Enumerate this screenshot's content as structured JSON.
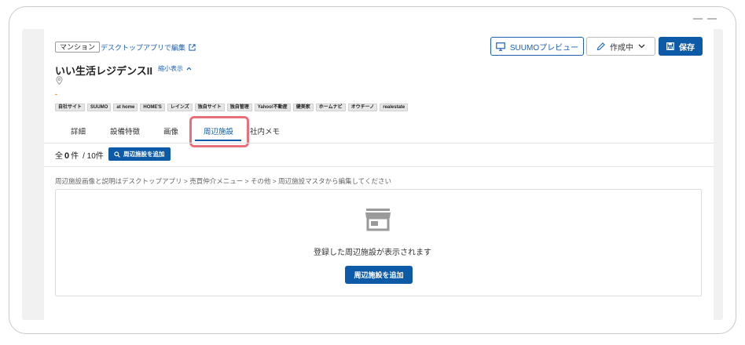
{
  "header": {
    "property_type": "マンション",
    "desktop_edit_link": "デスクトップアプリで編集",
    "title": "いい生活レジデンスII",
    "collapse_label": "縮小表示",
    "price_placeholder": "-"
  },
  "toolbar": {
    "preview_label": "SUUMOプレビュー",
    "status_label": "作成中",
    "save_label": "保存"
  },
  "portals": [
    "自社サイト",
    "SUUMO",
    "at home",
    "HOME'S",
    "レインズ",
    "独自サイト",
    "独自管理",
    "Yahoo!不動産",
    "健美家",
    "ホームナビ",
    "オウチーノ",
    "realestate"
  ],
  "tabs": [
    {
      "label": "詳細",
      "active": false
    },
    {
      "label": "設備特徴",
      "active": false
    },
    {
      "label": "画像",
      "active": false
    },
    {
      "label": "周辺施設",
      "active": true
    },
    {
      "label": "社内メモ",
      "active": false
    }
  ],
  "facilities": {
    "count_prefix": "全",
    "count": "0",
    "count_unit": "件",
    "total_label": "/ 10件",
    "add_button_small": "周辺施設を追加",
    "hint": "周辺施設画像と説明はデスクトップアプリ > 売買仲介メニュー > その他 > 周辺施設マスタから編集してください",
    "empty_message": "登録した周辺施設が表示されます",
    "add_button_big": "周辺施設を追加"
  },
  "colors": {
    "primary": "#0d5aa7",
    "highlight": "#e8707b",
    "price": "#e08a2a"
  },
  "icons": [
    "external-link-icon",
    "monitor-icon",
    "pencil-icon",
    "chevron-down-icon",
    "save-icon",
    "chevron-up-icon",
    "map-pin-icon",
    "search-icon",
    "store-icon"
  ]
}
